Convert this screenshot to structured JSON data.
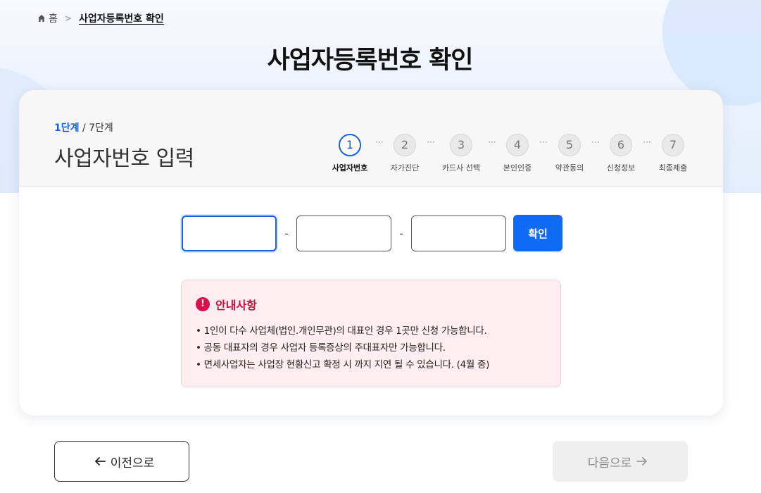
{
  "breadcrumb": {
    "home_label": "홈",
    "current_label": "사업자등록번호 확인"
  },
  "page": {
    "title": "사업자등록번호 확인"
  },
  "step_info": {
    "current": "1단계",
    "total": " / 7단계",
    "section_title": "사업자번호 입력"
  },
  "stepper": {
    "steps": [
      {
        "number": "1",
        "label": "사업자번호",
        "active": true
      },
      {
        "number": "2",
        "label": "자가진단",
        "active": false
      },
      {
        "number": "3",
        "label": "카드사 선택",
        "active": false
      },
      {
        "number": "4",
        "label": "본인인증",
        "active": false
      },
      {
        "number": "5",
        "label": "약관동의",
        "active": false
      },
      {
        "number": "6",
        "label": "신청정보",
        "active": false
      },
      {
        "number": "7",
        "label": "최종제출",
        "active": false
      }
    ],
    "connector": "···"
  },
  "form": {
    "part1_value": "",
    "part2_value": "",
    "part3_value": "",
    "separator": "-",
    "confirm_label": "확인"
  },
  "notice": {
    "icon": "!",
    "title": "안내사항",
    "items": [
      "• 1인이 다수 사업체(법인.개인무관)의 대표인 경우 1곳만 신청 가능합니다.",
      "• 공동 대표자의 경우 사업자 등록증상의 주대표자만 가능합니다.",
      "• 면세사업자는 사업장 현황신고 확정 시 까지 지연 될 수 있습니다. (4월 중)"
    ]
  },
  "nav": {
    "prev_label": "이전으로",
    "next_label": "다음으로"
  },
  "icons": {
    "home": "home-icon",
    "chevron": "chevron-right-icon",
    "alert": "alert-icon",
    "arrow_left": "arrow-left-icon",
    "arrow_right": "arrow-right-icon"
  },
  "colors": {
    "accent": "#0f6bf5",
    "active_step": "#1a5fe0",
    "notice_title": "#c8103f",
    "notice_bg": "#ffeef1"
  }
}
